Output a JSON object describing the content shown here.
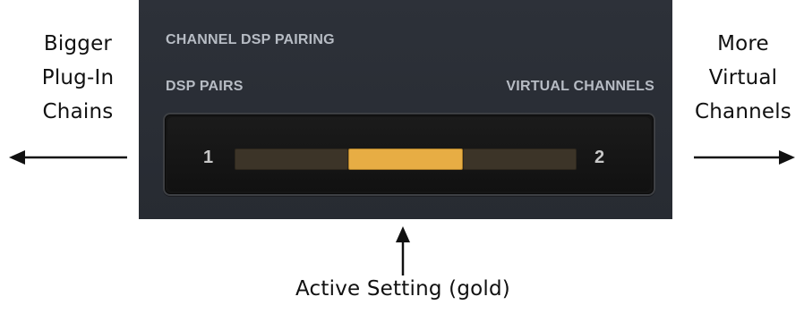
{
  "panel": {
    "title": "CHANNEL DSP PAIRING",
    "left_label": "DSP PAIRS",
    "right_label": "VIRTUAL CHANNELS",
    "left_value": "1",
    "right_value": "2"
  },
  "slider": {
    "segments": 3,
    "active_segment": 1,
    "active_color": "#e7ad44",
    "inactive_color": "#3c3428"
  },
  "callouts": {
    "left": [
      "Bigger",
      "Plug-In",
      "Chains"
    ],
    "right": [
      "More",
      "Virtual",
      "Channels"
    ],
    "bottom": "Active Setting (gold)"
  },
  "icons": {
    "left_arrow": "arrow-left-icon",
    "right_arrow": "arrow-right-icon",
    "up_arrow": "arrow-up-icon"
  }
}
